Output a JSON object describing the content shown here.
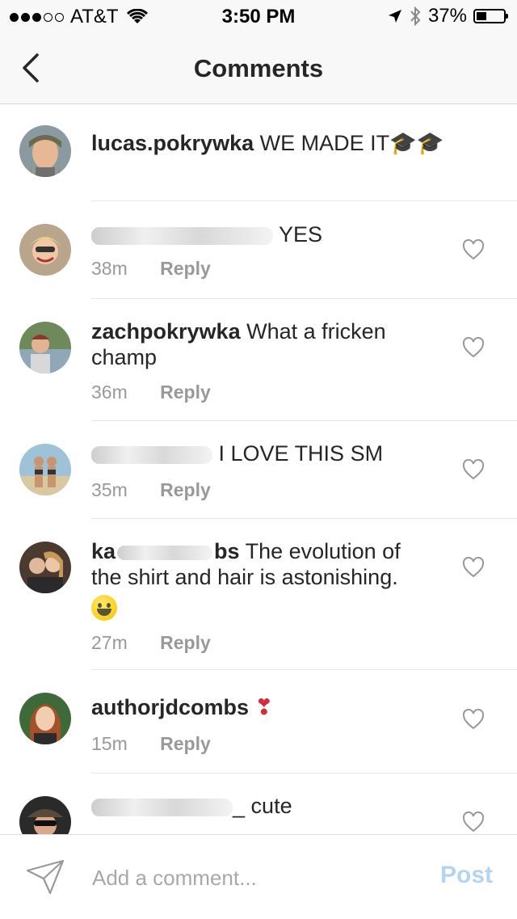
{
  "status_bar": {
    "carrier": "AT&T",
    "time": "3:50 PM",
    "battery": "37%",
    "signal_bars": 3,
    "signal_total": 5,
    "battery_level": 0.37
  },
  "nav": {
    "title": "Comments",
    "back_icon": "chevron-left-icon"
  },
  "comments": [
    {
      "username": "lucas.pokrywka",
      "text": "WE MADE IT",
      "emoji": "🎓🎓",
      "time": "",
      "reply": ""
    },
    {
      "username": "",
      "username_redacted": true,
      "text": "YES",
      "time": "38m",
      "reply": "Reply"
    },
    {
      "username": "zachpokrywka",
      "text": "What a fricken champ",
      "time": "36m",
      "reply": "Reply"
    },
    {
      "username": "",
      "username_redacted": true,
      "text": "I LOVE THIS SM",
      "time": "35m",
      "reply": "Reply"
    },
    {
      "username": "ka",
      "username_suffix": "bs",
      "username_redacted": true,
      "text": "The evolution of the shirt and hair is astonishing.",
      "time": "27m",
      "reply": "Reply"
    },
    {
      "username": "authorjdcombs",
      "text": "❣",
      "time": "15m",
      "reply": "Reply"
    },
    {
      "username": "",
      "username_suffix": "_",
      "username_redacted": true,
      "text": "cute",
      "time": "",
      "reply": ""
    }
  ],
  "composer": {
    "placeholder": "Add a comment...",
    "post_label": "Post",
    "send_icon": "send-icon"
  },
  "colors": {
    "post_disabled": "#b3d4f5",
    "muted": "#999999",
    "text": "#262626"
  }
}
